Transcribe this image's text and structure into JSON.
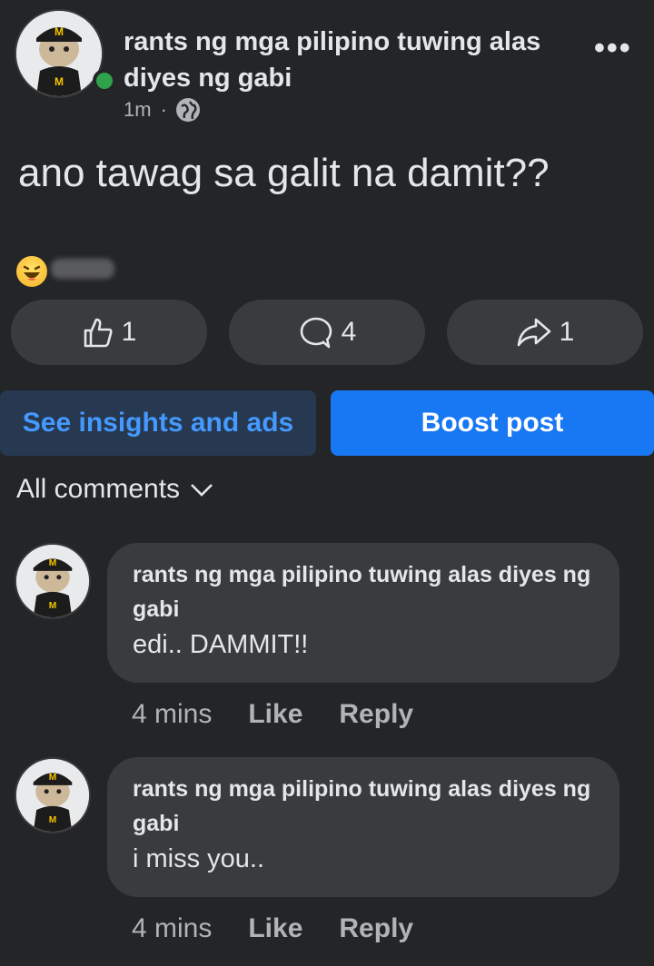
{
  "post": {
    "page_name": "rants ng mga pilipino tuwing alas diyes ng gabi",
    "time": "1m",
    "separator": "·",
    "privacy_icon": "globe-icon",
    "more_icon": "more-horizontal-icon",
    "more_label": "•••",
    "text": "ano tawag sa galit na damit??",
    "reaction_icon": "haha-emoji-icon"
  },
  "actions": {
    "like_count": "1",
    "comment_count": "4",
    "share_count": "1"
  },
  "buttons": {
    "insights": "See insights and ads",
    "boost": "Boost post"
  },
  "comments_filter": {
    "label": "All comments"
  },
  "comments": [
    {
      "author": "rants ng mga pilipino tuwing alas diyes ng gabi",
      "text": "edi.. DAMMIT!!",
      "time": "4 mins",
      "like": "Like",
      "reply": "Reply"
    },
    {
      "author": "rants ng mga pilipino tuwing alas diyes ng gabi",
      "text": "i miss you..",
      "time": "4 mins",
      "like": "Like",
      "reply": "Reply"
    }
  ],
  "colors": {
    "background": "#242526",
    "surface": "#3a3b3c",
    "accent": "#1877f2",
    "online": "#31a24c"
  }
}
